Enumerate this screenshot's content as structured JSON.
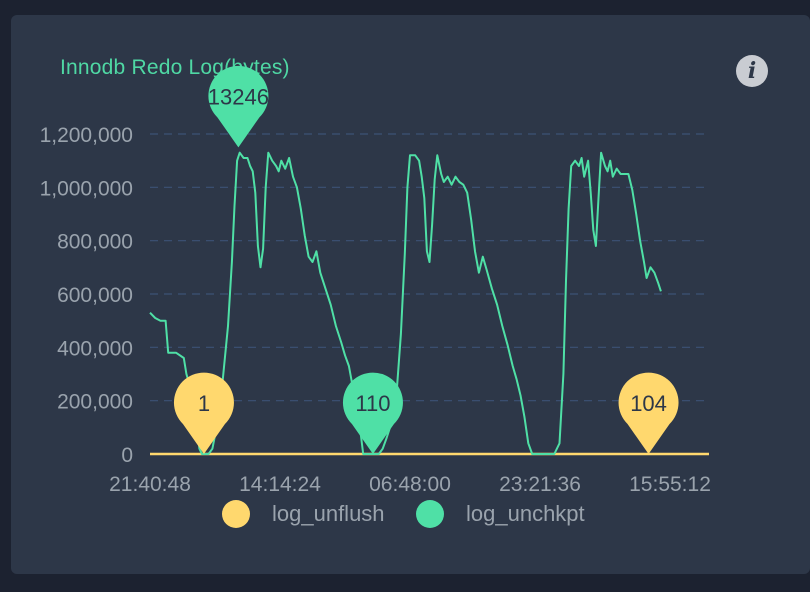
{
  "title": "Innodb Redo Log(bytes)",
  "info_icon": "info-icon",
  "colors": {
    "background": "#2d3748",
    "grid": "#3c5275",
    "axis_text": "#9aa3ad",
    "log_unflush": "#ffd86e",
    "log_unchkpt": "#4fe0a6"
  },
  "chart_data": {
    "type": "line",
    "title": "Innodb Redo Log(bytes)",
    "xlabel": "",
    "ylabel": "",
    "ylim": [
      0,
      1200000
    ],
    "y_ticks": [
      "0",
      "200,000",
      "400,000",
      "600,000",
      "800,000",
      "1,000,000",
      "1,200,000"
    ],
    "x_tick_labels": [
      "21:40:48",
      "14:14:24",
      "06:48:00",
      "23:21:36",
      "15:55:12"
    ],
    "x_tick_positions": [
      0,
      0.2,
      0.4,
      0.6,
      0.8
    ],
    "x_end": 0.86,
    "grid": true,
    "legend_position": "bottom",
    "series": [
      {
        "name": "log_unflush",
        "color": "#ffd86e",
        "points": [
          [
            0,
            0
          ],
          [
            0.86,
            0
          ]
        ]
      },
      {
        "name": "log_unchkpt",
        "color": "#4fe0a6",
        "points": [
          [
            0.0,
            530000
          ],
          [
            0.008,
            510000
          ],
          [
            0.016,
            500000
          ],
          [
            0.024,
            500000
          ],
          [
            0.028,
            380000
          ],
          [
            0.04,
            380000
          ],
          [
            0.052,
            360000
          ],
          [
            0.056,
            300000
          ],
          [
            0.062,
            250000
          ],
          [
            0.068,
            180000
          ],
          [
            0.072,
            100000
          ],
          [
            0.076,
            20000
          ],
          [
            0.08,
            0
          ],
          [
            0.09,
            0
          ],
          [
            0.096,
            20000
          ],
          [
            0.104,
            120000
          ],
          [
            0.112,
            280000
          ],
          [
            0.12,
            480000
          ],
          [
            0.126,
            720000
          ],
          [
            0.13,
            930000
          ],
          [
            0.134,
            1100000
          ],
          [
            0.138,
            1130000
          ],
          [
            0.144,
            1110000
          ],
          [
            0.15,
            1110000
          ],
          [
            0.154,
            1080000
          ],
          [
            0.158,
            1060000
          ],
          [
            0.162,
            980000
          ],
          [
            0.166,
            780000
          ],
          [
            0.17,
            700000
          ],
          [
            0.174,
            770000
          ],
          [
            0.178,
            1000000
          ],
          [
            0.182,
            1130000
          ],
          [
            0.188,
            1100000
          ],
          [
            0.194,
            1080000
          ],
          [
            0.198,
            1060000
          ],
          [
            0.202,
            1100000
          ],
          [
            0.208,
            1070000
          ],
          [
            0.214,
            1110000
          ],
          [
            0.22,
            1040000
          ],
          [
            0.226,
            1000000
          ],
          [
            0.232,
            920000
          ],
          [
            0.238,
            820000
          ],
          [
            0.244,
            740000
          ],
          [
            0.25,
            720000
          ],
          [
            0.256,
            760000
          ],
          [
            0.262,
            680000
          ],
          [
            0.27,
            620000
          ],
          [
            0.278,
            560000
          ],
          [
            0.286,
            480000
          ],
          [
            0.294,
            420000
          ],
          [
            0.3,
            370000
          ],
          [
            0.306,
            330000
          ],
          [
            0.312,
            250000
          ],
          [
            0.318,
            150000
          ],
          [
            0.324,
            80000
          ],
          [
            0.328,
            0
          ],
          [
            0.34,
            0
          ],
          [
            0.352,
            0
          ],
          [
            0.358,
            20000
          ],
          [
            0.364,
            60000
          ],
          [
            0.372,
            120000
          ],
          [
            0.38,
            250000
          ],
          [
            0.386,
            450000
          ],
          [
            0.392,
            750000
          ],
          [
            0.396,
            1000000
          ],
          [
            0.4,
            1120000
          ],
          [
            0.408,
            1120000
          ],
          [
            0.414,
            1100000
          ],
          [
            0.418,
            1040000
          ],
          [
            0.422,
            960000
          ],
          [
            0.426,
            760000
          ],
          [
            0.43,
            720000
          ],
          [
            0.434,
            860000
          ],
          [
            0.438,
            1030000
          ],
          [
            0.442,
            1120000
          ],
          [
            0.448,
            1050000
          ],
          [
            0.452,
            1020000
          ],
          [
            0.458,
            1040000
          ],
          [
            0.464,
            1010000
          ],
          [
            0.47,
            1040000
          ],
          [
            0.476,
            1020000
          ],
          [
            0.482,
            1010000
          ],
          [
            0.488,
            980000
          ],
          [
            0.494,
            880000
          ],
          [
            0.5,
            760000
          ],
          [
            0.506,
            680000
          ],
          [
            0.512,
            740000
          ],
          [
            0.518,
            690000
          ],
          [
            0.526,
            620000
          ],
          [
            0.534,
            560000
          ],
          [
            0.542,
            480000
          ],
          [
            0.55,
            410000
          ],
          [
            0.558,
            330000
          ],
          [
            0.564,
            280000
          ],
          [
            0.57,
            220000
          ],
          [
            0.576,
            140000
          ],
          [
            0.582,
            40000
          ],
          [
            0.588,
            0
          ],
          [
            0.6,
            0
          ],
          [
            0.622,
            0
          ],
          [
            0.63,
            40000
          ],
          [
            0.636,
            300000
          ],
          [
            0.64,
            650000
          ],
          [
            0.644,
            920000
          ],
          [
            0.648,
            1080000
          ],
          [
            0.654,
            1100000
          ],
          [
            0.66,
            1080000
          ],
          [
            0.664,
            1110000
          ],
          [
            0.668,
            1040000
          ],
          [
            0.674,
            1100000
          ],
          [
            0.678,
            980000
          ],
          [
            0.682,
            840000
          ],
          [
            0.686,
            780000
          ],
          [
            0.69,
            960000
          ],
          [
            0.694,
            1130000
          ],
          [
            0.7,
            1080000
          ],
          [
            0.704,
            1060000
          ],
          [
            0.708,
            1100000
          ],
          [
            0.712,
            1040000
          ],
          [
            0.718,
            1070000
          ],
          [
            0.724,
            1050000
          ],
          [
            0.73,
            1050000
          ],
          [
            0.736,
            1050000
          ],
          [
            0.742,
            990000
          ],
          [
            0.748,
            900000
          ],
          [
            0.754,
            800000
          ],
          [
            0.76,
            720000
          ],
          [
            0.764,
            660000
          ],
          [
            0.77,
            700000
          ],
          [
            0.776,
            680000
          ],
          [
            0.782,
            640000
          ],
          [
            0.786,
            610000
          ]
        ]
      }
    ],
    "annotations": [
      {
        "label": "1",
        "series": "log_unflush",
        "x": 0.083,
        "y": 0
      },
      {
        "label": "110",
        "series": "log_unchkpt",
        "x": 0.343,
        "y": 0
      },
      {
        "label": "104",
        "series": "log_unflush",
        "x": 0.767,
        "y": 0
      },
      {
        "label": "13246",
        "series": "log_unchkpt",
        "x": 0.136,
        "y": 1150000
      }
    ]
  },
  "legend": [
    {
      "label": "log_unflush",
      "color": "#ffd86e"
    },
    {
      "label": "log_unchkpt",
      "color": "#4fe0a6"
    }
  ]
}
